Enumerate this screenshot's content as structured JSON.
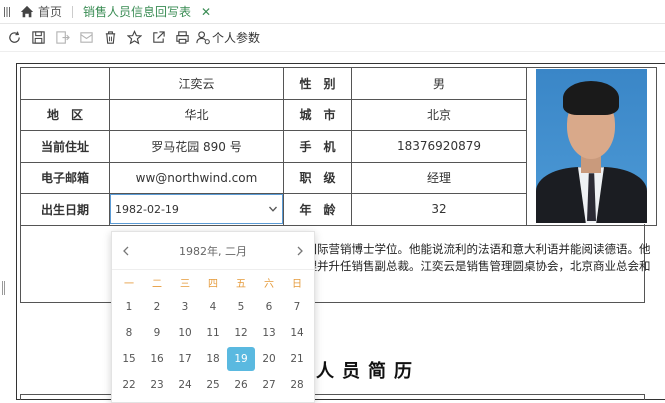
{
  "tabs": {
    "home_label": "首页",
    "active_label": "销售人员信息回写表",
    "close_glyph": "✕"
  },
  "toolbar": {
    "person_params_label": "个人参数"
  },
  "form": {
    "name": "江奕云",
    "gender_label": "性　别",
    "gender": "男",
    "region_label": "地　区",
    "region": "华北",
    "city_label": "城　市",
    "city": "北京",
    "address_label": "当前住址",
    "address": "罗马花园 890 号",
    "phone_label": "手　机",
    "phone": "18376920879",
    "email_label": "电子邮箱",
    "email": "ww@northwind.com",
    "title_label": "职　级",
    "title": "经理",
    "birth_label": "出生日期",
    "birth": "1982-02-19",
    "age_label": "年　龄",
    "age": "32"
  },
  "bio": {
    "line1": "交国际营销博士学位。他能说流利的法语和意大利语并能阅读德语。他",
    "line2": "经理并升任销售副总裁。江奕云是销售管理圆桌协会，北京商业总会和"
  },
  "section_title": "人员简历",
  "calendar": {
    "title": "1982年, 二月",
    "weekdays": [
      "一",
      "二",
      "三",
      "四",
      "五",
      "六",
      "日"
    ],
    "weeks": [
      [
        "1",
        "2",
        "3",
        "4",
        "5",
        "6",
        "7"
      ],
      [
        "8",
        "9",
        "10",
        "11",
        "12",
        "13",
        "14"
      ],
      [
        "15",
        "16",
        "17",
        "18",
        "19",
        "20",
        "21"
      ],
      [
        "22",
        "23",
        "24",
        "25",
        "26",
        "27",
        "28"
      ]
    ],
    "selected": "19",
    "accent": "#5ab9e0",
    "weekday_color": "#e59a3a"
  },
  "colors": {
    "active_tab": "#3a8c54",
    "input_border": "#5b9bd5"
  }
}
